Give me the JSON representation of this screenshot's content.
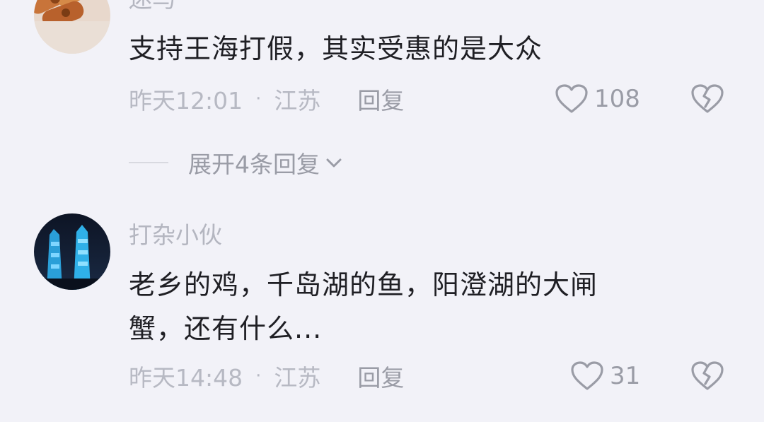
{
  "comments": [
    {
      "username": "迷马",
      "content": "支持王海打假，其实受惠的是大众",
      "time": "昨天12:01",
      "location": "江苏",
      "reply_label": "回复",
      "likes": "108",
      "expand_label": "展开4条回复"
    },
    {
      "username": "打杂小伙",
      "content_line1": "老乡的鸡，千岛湖的鱼，阳澄湖的大闸",
      "content_line2": "蟹，还有什么...",
      "time": "昨天14:48",
      "location": "江苏",
      "reply_label": "回复",
      "likes": "31"
    }
  ],
  "separator": "·",
  "colors": {
    "background": "#f2f2f8",
    "text_primary": "#1f1f24",
    "text_secondary": "#b7b9c3",
    "icon": "#9a9ca6"
  },
  "icons": {
    "like": "heart-outline-icon",
    "dislike": "broken-heart-icon",
    "expand": "chevron-down-icon"
  }
}
